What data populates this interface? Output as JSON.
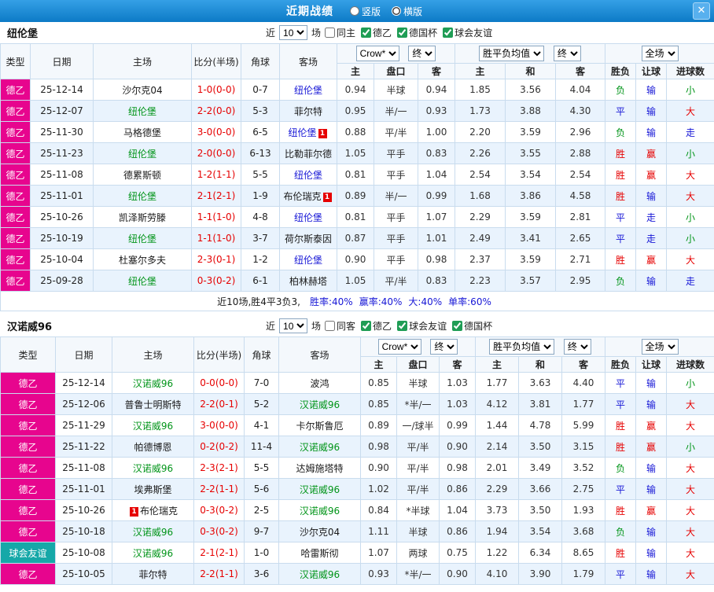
{
  "titlebar": {
    "title": "近期战绩",
    "modes": [
      {
        "label": "竖版",
        "selected": false
      },
      {
        "label": "横版",
        "selected": true
      }
    ],
    "close": "✕"
  },
  "palette": {
    "titlebar_blue": "#0c7ac6",
    "league_magenta": "#e7058e",
    "league_teal": "#16a8a8",
    "home_focus_green": "#009418",
    "away_focus_blue": "#1616d6",
    "score_red": "#e60000",
    "result_red": "#e60000",
    "result_blue": "#1616d6",
    "result_green": "#009418"
  },
  "columns": {
    "near": "近",
    "count": "10",
    "games": "场",
    "type": "类型",
    "date": "日期",
    "home": "主场",
    "score": "比分(半场)",
    "corner": "角球",
    "away": "客场",
    "odds_source": "Crow*",
    "final": "终",
    "avg": "胜平负均值",
    "fullmatch": "全场",
    "sub": [
      "主",
      "盘口",
      "客",
      "主",
      "和",
      "客",
      "胜负",
      "让球",
      "进球数"
    ]
  },
  "sections": [
    {
      "team": "纽伦堡",
      "checks": [
        {
          "label": "同主",
          "checked": false
        },
        {
          "label": "德乙",
          "checked": true
        },
        {
          "label": "德国杯",
          "checked": true
        },
        {
          "label": "球会友谊",
          "checked": true
        }
      ],
      "rows": [
        {
          "league": "德乙",
          "league_color": "magenta",
          "date": "25-12-14",
          "home": "沙尔克04",
          "home_color": "black",
          "score": "1-0(0-0)",
          "corner": "0-7",
          "away": "纽伦堡",
          "away_color": "blue",
          "odds": [
            "0.94",
            "半球",
            "0.94"
          ],
          "avg": [
            "1.85",
            "3.56",
            "4.04"
          ],
          "outcome": "负",
          "outcome_color": "green",
          "handicap": "输",
          "handicap_color": "blue",
          "goals": "小",
          "goals_color": "green"
        },
        {
          "league": "德乙",
          "league_color": "magenta",
          "date": "25-12-07",
          "home": "纽伦堡",
          "home_color": "green",
          "score": "2-2(0-0)",
          "corner": "5-3",
          "away": "菲尔特",
          "away_color": "black",
          "odds": [
            "0.95",
            "半/一",
            "0.93"
          ],
          "avg": [
            "1.73",
            "3.88",
            "4.30"
          ],
          "outcome": "平",
          "outcome_color": "blue",
          "handicap": "输",
          "handicap_color": "blue",
          "goals": "大",
          "goals_color": "red"
        },
        {
          "league": "德乙",
          "league_color": "magenta",
          "date": "25-11-30",
          "home": "马格德堡",
          "home_color": "black",
          "score": "3-0(0-0)",
          "corner": "6-5",
          "away": "纽伦堡",
          "away_color": "blue",
          "away_badge": "1",
          "odds": [
            "0.88",
            "平/半",
            "1.00"
          ],
          "avg": [
            "2.20",
            "3.59",
            "2.96"
          ],
          "outcome": "负",
          "outcome_color": "green",
          "handicap": "输",
          "handicap_color": "blue",
          "goals": "走",
          "goals_color": "blue"
        },
        {
          "league": "德乙",
          "league_color": "magenta",
          "date": "25-11-23",
          "home": "纽伦堡",
          "home_color": "green",
          "score": "2-0(0-0)",
          "corner": "6-13",
          "away": "比勒菲尔德",
          "away_color": "black",
          "odds": [
            "1.05",
            "平手",
            "0.83"
          ],
          "avg": [
            "2.26",
            "3.55",
            "2.88"
          ],
          "outcome": "胜",
          "outcome_color": "red",
          "handicap": "赢",
          "handicap_color": "red",
          "goals": "小",
          "goals_color": "green"
        },
        {
          "league": "德乙",
          "league_color": "magenta",
          "date": "25-11-08",
          "home": "德累斯顿",
          "home_color": "black",
          "score": "1-2(1-1)",
          "corner": "5-5",
          "away": "纽伦堡",
          "away_color": "blue",
          "odds": [
            "0.81",
            "平手",
            "1.04"
          ],
          "avg": [
            "2.54",
            "3.54",
            "2.54"
          ],
          "outcome": "胜",
          "outcome_color": "red",
          "handicap": "赢",
          "handicap_color": "red",
          "goals": "大",
          "goals_color": "red"
        },
        {
          "league": "德乙",
          "league_color": "magenta",
          "date": "25-11-01",
          "home": "纽伦堡",
          "home_color": "green",
          "score": "2-1(2-1)",
          "corner": "1-9",
          "away": "布伦瑞克",
          "away_color": "black",
          "away_badge": "1",
          "odds": [
            "0.89",
            "半/一",
            "0.99"
          ],
          "avg": [
            "1.68",
            "3.86",
            "4.58"
          ],
          "outcome": "胜",
          "outcome_color": "red",
          "handicap": "输",
          "handicap_color": "blue",
          "goals": "大",
          "goals_color": "red"
        },
        {
          "league": "德乙",
          "league_color": "magenta",
          "date": "25-10-26",
          "home": "凯泽斯劳滕",
          "home_color": "black",
          "score": "1-1(1-0)",
          "corner": "4-8",
          "away": "纽伦堡",
          "away_color": "blue",
          "odds": [
            "0.81",
            "平手",
            "1.07"
          ],
          "avg": [
            "2.29",
            "3.59",
            "2.81"
          ],
          "outcome": "平",
          "outcome_color": "blue",
          "handicap": "走",
          "handicap_color": "blue",
          "goals": "小",
          "goals_color": "green"
        },
        {
          "league": "德乙",
          "league_color": "magenta",
          "date": "25-10-19",
          "home": "纽伦堡",
          "home_color": "green",
          "score": "1-1(1-0)",
          "corner": "3-7",
          "away": "荷尔斯泰因",
          "away_color": "black",
          "odds": [
            "0.87",
            "平手",
            "1.01"
          ],
          "avg": [
            "2.49",
            "3.41",
            "2.65"
          ],
          "outcome": "平",
          "outcome_color": "blue",
          "handicap": "走",
          "handicap_color": "blue",
          "goals": "小",
          "goals_color": "green"
        },
        {
          "league": "德乙",
          "league_color": "magenta",
          "date": "25-10-04",
          "home": "杜塞尔多夫",
          "home_color": "black",
          "score": "2-3(0-1)",
          "corner": "1-2",
          "away": "纽伦堡",
          "away_color": "blue",
          "odds": [
            "0.90",
            "平手",
            "0.98"
          ],
          "avg": [
            "2.37",
            "3.59",
            "2.71"
          ],
          "outcome": "胜",
          "outcome_color": "red",
          "handicap": "赢",
          "handicap_color": "red",
          "goals": "大",
          "goals_color": "red"
        },
        {
          "league": "德乙",
          "league_color": "magenta",
          "date": "25-09-28",
          "home": "纽伦堡",
          "home_color": "green",
          "score": "0-3(0-2)",
          "corner": "6-1",
          "away": "柏林赫塔",
          "away_color": "black",
          "odds": [
            "1.05",
            "平/半",
            "0.83"
          ],
          "avg": [
            "2.23",
            "3.57",
            "2.95"
          ],
          "outcome": "负",
          "outcome_color": "green",
          "handicap": "输",
          "handicap_color": "blue",
          "goals": "走",
          "goals_color": "blue"
        }
      ],
      "summary": [
        {
          "t": "近10场,胜4平3负3,",
          "c": "black"
        },
        {
          "t": "胜率:40%",
          "c": "blue"
        },
        {
          "t": "赢率:40%",
          "c": "blue"
        },
        {
          "t": "大:40%",
          "c": "blue"
        },
        {
          "t": "单率:60%",
          "c": "blue"
        }
      ]
    },
    {
      "team": "汉诺威96",
      "checks": [
        {
          "label": "同客",
          "checked": false
        },
        {
          "label": "德乙",
          "checked": true
        },
        {
          "label": "球会友谊",
          "checked": true
        },
        {
          "label": "德国杯",
          "checked": true
        }
      ],
      "rows": [
        {
          "league": "德乙",
          "league_color": "magenta",
          "date": "25-12-14",
          "home": "汉诺威96",
          "home_color": "green",
          "score": "0-0(0-0)",
          "corner": "7-0",
          "away": "波鸿",
          "away_color": "black",
          "odds": [
            "0.85",
            "半球",
            "1.03"
          ],
          "avg": [
            "1.77",
            "3.63",
            "4.40"
          ],
          "outcome": "平",
          "outcome_color": "blue",
          "handicap": "输",
          "handicap_color": "blue",
          "goals": "小",
          "goals_color": "green"
        },
        {
          "league": "德乙",
          "league_color": "magenta",
          "date": "25-12-06",
          "home": "普鲁士明斯特",
          "home_color": "black",
          "score": "2-2(0-1)",
          "corner": "5-2",
          "away": "汉诺威96",
          "away_color": "green",
          "odds": [
            "0.85",
            "*半/一",
            "1.03"
          ],
          "avg": [
            "4.12",
            "3.81",
            "1.77"
          ],
          "outcome": "平",
          "outcome_color": "blue",
          "handicap": "输",
          "handicap_color": "blue",
          "goals": "大",
          "goals_color": "red"
        },
        {
          "league": "德乙",
          "league_color": "magenta",
          "date": "25-11-29",
          "home": "汉诺威96",
          "home_color": "green",
          "score": "3-0(0-0)",
          "corner": "4-1",
          "away": "卡尔斯鲁厄",
          "away_color": "black",
          "odds": [
            "0.89",
            "一/球半",
            "0.99"
          ],
          "avg": [
            "1.44",
            "4.78",
            "5.99"
          ],
          "outcome": "胜",
          "outcome_color": "red",
          "handicap": "赢",
          "handicap_color": "red",
          "goals": "大",
          "goals_color": "red"
        },
        {
          "league": "德乙",
          "league_color": "magenta",
          "date": "25-11-22",
          "home": "帕德博恩",
          "home_color": "black",
          "score": "0-2(0-2)",
          "corner": "11-4",
          "away": "汉诺威96",
          "away_color": "green",
          "odds": [
            "0.98",
            "平/半",
            "0.90"
          ],
          "avg": [
            "2.14",
            "3.50",
            "3.15"
          ],
          "outcome": "胜",
          "outcome_color": "red",
          "handicap": "赢",
          "handicap_color": "red",
          "goals": "小",
          "goals_color": "green"
        },
        {
          "league": "德乙",
          "league_color": "magenta",
          "date": "25-11-08",
          "home": "汉诺威96",
          "home_color": "green",
          "score": "2-3(2-1)",
          "corner": "5-5",
          "away": "达姆施塔特",
          "away_color": "black",
          "odds": [
            "0.90",
            "平/半",
            "0.98"
          ],
          "avg": [
            "2.01",
            "3.49",
            "3.52"
          ],
          "outcome": "负",
          "outcome_color": "green",
          "handicap": "输",
          "handicap_color": "blue",
          "goals": "大",
          "goals_color": "red"
        },
        {
          "league": "德乙",
          "league_color": "magenta",
          "date": "25-11-01",
          "home": "埃弗斯堡",
          "home_color": "black",
          "score": "2-2(1-1)",
          "corner": "5-6",
          "away": "汉诺威96",
          "away_color": "green",
          "odds": [
            "1.02",
            "平/半",
            "0.86"
          ],
          "avg": [
            "2.29",
            "3.66",
            "2.75"
          ],
          "outcome": "平",
          "outcome_color": "blue",
          "handicap": "输",
          "handicap_color": "blue",
          "goals": "大",
          "goals_color": "red"
        },
        {
          "league": "德乙",
          "league_color": "magenta",
          "date": "25-10-26",
          "home": "布伦瑞克",
          "home_color": "black",
          "home_badge": "1",
          "home_badge_pos": "before",
          "score": "0-3(0-2)",
          "corner": "2-5",
          "away": "汉诺威96",
          "away_color": "green",
          "odds": [
            "0.84",
            "*半球",
            "1.04"
          ],
          "avg": [
            "3.73",
            "3.50",
            "1.93"
          ],
          "outcome": "胜",
          "outcome_color": "red",
          "handicap": "赢",
          "handicap_color": "red",
          "goals": "大",
          "goals_color": "red"
        },
        {
          "league": "德乙",
          "league_color": "magenta",
          "date": "25-10-18",
          "home": "汉诺威96",
          "home_color": "green",
          "score": "0-3(0-2)",
          "corner": "9-7",
          "away": "沙尔克04",
          "away_color": "black",
          "odds": [
            "1.11",
            "半球",
            "0.86"
          ],
          "avg": [
            "1.94",
            "3.54",
            "3.68"
          ],
          "outcome": "负",
          "outcome_color": "green",
          "handicap": "输",
          "handicap_color": "blue",
          "goals": "大",
          "goals_color": "red"
        },
        {
          "league": "球会友谊",
          "league_color": "teal",
          "date": "25-10-08",
          "home": "汉诺威96",
          "home_color": "green",
          "score": "2-1(2-1)",
          "corner": "1-0",
          "away": "哈雷斯彻",
          "away_color": "black",
          "odds": [
            "1.07",
            "两球",
            "0.75"
          ],
          "avg": [
            "1.22",
            "6.34",
            "8.65"
          ],
          "outcome": "胜",
          "outcome_color": "red",
          "handicap": "输",
          "handicap_color": "blue",
          "goals": "大",
          "goals_color": "red"
        },
        {
          "league": "德乙",
          "league_color": "magenta",
          "date": "25-10-05",
          "home": "菲尔特",
          "home_color": "black",
          "score": "2-2(1-1)",
          "corner": "3-6",
          "away": "汉诺威96",
          "away_color": "green",
          "odds": [
            "0.93",
            "*半/一",
            "0.90"
          ],
          "avg": [
            "4.10",
            "3.90",
            "1.79"
          ],
          "outcome": "平",
          "outcome_color": "blue",
          "handicap": "输",
          "handicap_color": "blue",
          "goals": "大",
          "goals_color": "red"
        }
      ]
    }
  ]
}
